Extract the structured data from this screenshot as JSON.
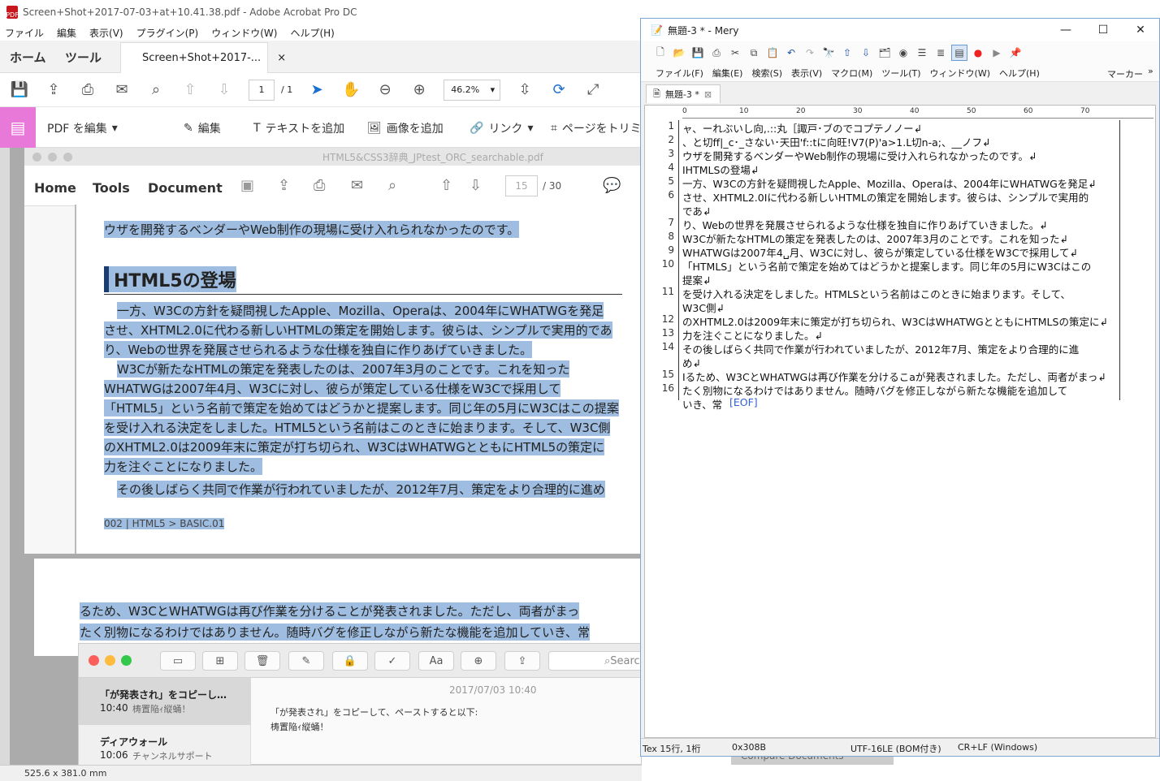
{
  "acrobat": {
    "title": "Screen+Shot+2017-07-03+at+10.41.38.pdf - Adobe Acrobat Pro DC",
    "menu": [
      "ファイル",
      "編集",
      "表示(V)",
      "プラグイン(P)",
      "ウィンドウ(W)",
      "ヘルプ(H)"
    ],
    "tab_home": "ホーム",
    "tab_tools": "ツール",
    "tab_doc": "Screen+Shot+2017-...",
    "tab_close": "×",
    "page_current": "1",
    "page_total": "/ 1",
    "zoom": "46.2%",
    "edit_pdf": "PDF を編集",
    "edit_items": [
      "編集",
      "テキストを追加",
      "画像を追加",
      "リンク",
      "ページをトリミ"
    ],
    "status": "525.6 x 381.0 mm"
  },
  "inner": {
    "title": "HTML5&CSS3辞典_JPtest_ORC_searchable.pdf",
    "nav": [
      "Home",
      "Tools",
      "Document"
    ],
    "page_current": "15",
    "page_total": "/ 30",
    "lines": [
      "ウザを開発するベンダーやWeb制作の現場に受け入れられなかったのです。",
      "HTML5の登場",
      "一方、W3Cの方針を疑問視したApple、Mozilla、Operaは、2004年にWHATWGを発足",
      "させ、XHTML2.0に代わる新しいHTMLの策定を開始します。彼らは、シンプルで実用的であ",
      "り、Webの世界を発展させられるような仕様を独自に作りあげていきました。",
      "W3Cが新たなHTMLの策定を発表したのは、2007年3月のことです。これを知った",
      "WHATWGは2007年4月、W3Cに対し、彼らが策定している仕様をW3Cで採用して",
      "「HTML5」という名前で策定を始めてはどうかと提案します。同じ年の5月にW3Cはこの提案",
      "を受け入れる決定をしました。HTML5という名前はこのときに始まります。そして、W3C側",
      "のXHTML2.0は2009年末に策定が打ち切られ、W3CはWHATWGとともにHTML5の策定に",
      "力を注ぐことになりました。",
      "その後しばらく共同で作業が行われていましたが、2012年7月、策定をより合理的に進め",
      "002 | HTML5 > BASIC.01"
    ],
    "page2_lines": [
      "るため、W3CとWHATWGは再び作業を分けることが発表されました。ただし、両者がまっ",
      "たく別物になるわけではありません。随時バグを修正しながら新たな機能を追加していき、常"
    ]
  },
  "notes": {
    "search_placeholder": "Search",
    "list": [
      {
        "title": "「が発表され」をコピーし…",
        "time": "10:40",
        "preview": "梼置陥ｨ縦蛹！"
      },
      {
        "title": "ディアウォール",
        "time": "10:06",
        "preview": "チャンネルサポート"
      }
    ],
    "date": "2017/07/03 10:40",
    "body1": "「が発表され」をコピーして、ペーストすると以下:",
    "body2": "梼置陥ｨ縦蛹！"
  },
  "mery": {
    "title": "無題-3 * - Mery",
    "menu": [
      "ファイル(F)",
      "編集(E)",
      "検索(S)",
      "表示(V)",
      "マクロ(M)",
      "ツール(T)",
      "ウィンドウ(W)",
      "ヘルプ(H)"
    ],
    "marker": "マーカー",
    "tab": "無題-3 *",
    "ruler": [
      "0",
      "10",
      "20",
      "30",
      "40",
      "50",
      "60",
      "70"
    ],
    "lines": [
      {
        "n": "1",
        "t": "ャ、ーれぶいし向,.::丸［諏戸･ブのでコプテノノー↲"
      },
      {
        "n": "2",
        "t": "、と切ff|_c･_さない･天田'f::tに向旺!V7(P)'a>1.L切n-a;、__ノフ↲"
      },
      {
        "n": "3",
        "t": "ウザを開発するベンダーやWeb制作の現場に受け入れられなかったのです。↲"
      },
      {
        "n": "4",
        "t": "IHTMLSの登場↲"
      },
      {
        "n": "5",
        "t": "一方、W3Cの方針を疑問視したApple、Mozilla、Operaは、2004年にWHATWGを発足↲"
      },
      {
        "n": "6",
        "t": "させ、XHTML2.0Iに代わる新しいHTMLの策定を開始します。彼らは、シンプルで実用的"
      },
      {
        "n": "",
        "t": "であ↲"
      },
      {
        "n": "7",
        "t": "り、Webの世界を発展させられるような仕様を独自に作りあげていきました。↲"
      },
      {
        "n": "8",
        "t": "W3Cが新たなHTMLの策定を発表したのは、2007年3月のことです。これを知った↲"
      },
      {
        "n": "9",
        "t": "WHATWGは2007年4␣月、W3Cに対し、彼らが策定している仕様をW3Cで採用して↲"
      },
      {
        "n": "10",
        "t": "「HTMLS」という名前で策定を始めてはどうかと提案します。同じ年の5月にW3Cはこの"
      },
      {
        "n": "",
        "t": "提案↲"
      },
      {
        "n": "11",
        "t": "を受け入れる決定をしました。HTMLSという名前はこのときに始まります。そして、"
      },
      {
        "n": "",
        "t": "W3C側↲"
      },
      {
        "n": "12",
        "t": "のXHTML2.0は2009年末に策定が打ち切られ、W3CはWHATWGとともにHTMLSの策定に↲"
      },
      {
        "n": "13",
        "t": "力を注ぐことになりました。↲"
      },
      {
        "n": "14",
        "t": "その後しばらく共同で作業が行われていましたが、2012年7月、策定をより合理的に進"
      },
      {
        "n": "",
        "t": "め↲"
      },
      {
        "n": "15",
        "t": "Ⅰるため、W3CとWHATWGは再び作業を分けるこaが発表されました。ただし、両者がまっ↲"
      },
      {
        "n": "16",
        "t": "たく別物になるわけではありません。随時バグを修正しながら新たな機能を追加して"
      },
      {
        "n": "",
        "t": "いき、常"
      }
    ],
    "eof": "[EOF]",
    "status": [
      "Tex 15行, 1桁",
      "0x308B",
      "UTF-16LE (BOM付き)",
      "CR+LF (Windows)"
    ]
  },
  "background": {
    "compare": "Compare Documents"
  }
}
